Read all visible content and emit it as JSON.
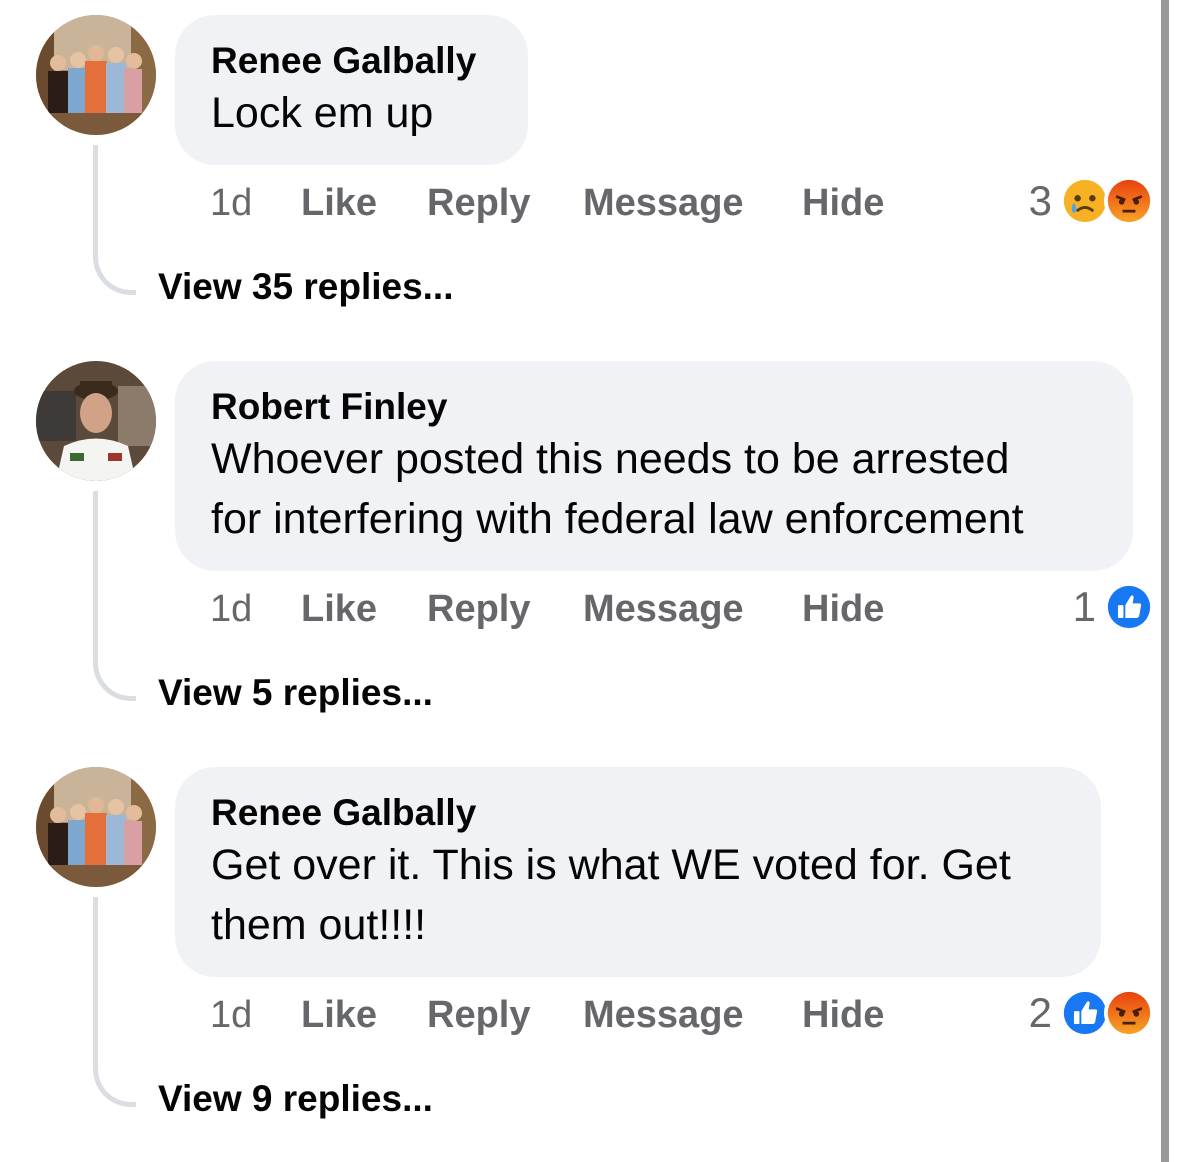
{
  "comments": [
    {
      "author": "Renee Galbally",
      "text_lines": [
        "Lock em up"
      ],
      "time": "1d",
      "actions": [
        "Like",
        "Reply",
        "Message",
        "Hide"
      ],
      "reaction_count": "3",
      "reactions": [
        "sad-reaction-icon",
        "angry-reaction-icon"
      ],
      "view_replies": "View 35 replies..."
    },
    {
      "author": "Robert Finley",
      "text_lines": [
        "Whoever posted this needs to be arrested",
        "for interfering with federal law enforcement"
      ],
      "time": "1d",
      "actions": [
        "Like",
        "Reply",
        "Message",
        "Hide"
      ],
      "reaction_count": "1",
      "reactions": [
        "like-reaction-icon"
      ],
      "view_replies": "View 5 replies..."
    },
    {
      "author": "Renee Galbally",
      "text_lines": [
        "Get over it. This is what WE voted for. Get",
        "them out!!!!"
      ],
      "time": "1d",
      "actions": [
        "Like",
        "Reply",
        "Message",
        "Hide"
      ],
      "reaction_count": "2",
      "reactions": [
        "like-reaction-icon",
        "angry-reaction-icon"
      ],
      "view_replies": "View 9 replies..."
    }
  ],
  "colors": {
    "bubble": "#f0f2f5",
    "secondary_text": "#65676b",
    "like_blue": "#1877f2",
    "angry_orange": "#e9710f",
    "sad_yellow": "#f7b125"
  }
}
